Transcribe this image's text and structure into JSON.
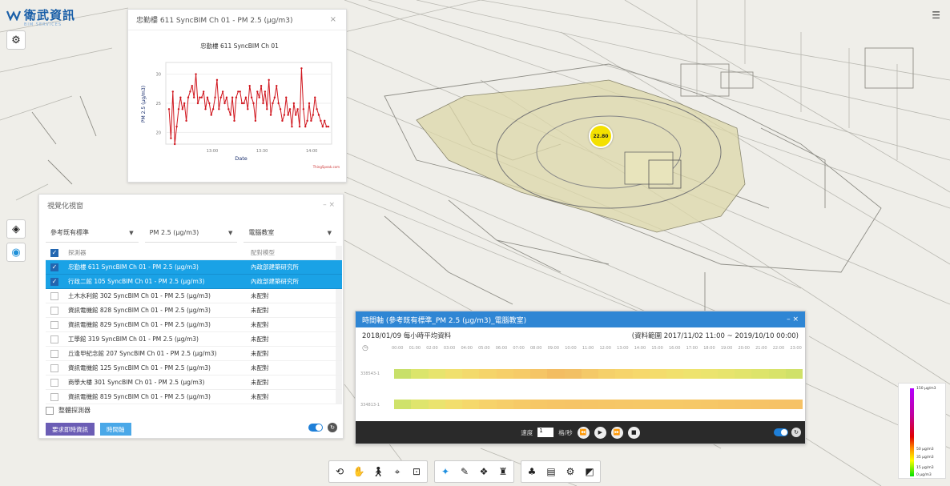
{
  "brand": {
    "name": "衛武資訊",
    "tagline": "BIM SERVICES"
  },
  "chart_panel": {
    "title": "忠勤樓 611 SyncBIM Ch 01 - PM 2.5 (μg/m3)",
    "close": "×"
  },
  "chart_data": {
    "type": "line",
    "title": "忠勤樓 611 SyncBIM Ch 01",
    "xlabel": "Date",
    "ylabel": "PM 2.5 (μg/m3)",
    "ylim": [
      18,
      32
    ],
    "yticks": [
      20,
      25,
      30
    ],
    "xticks": [
      "13:00",
      "13:30",
      "14:00"
    ],
    "credit": "ThingSpeak.com",
    "series": [
      {
        "color": "#d0161e",
        "values": [
          24,
          19,
          27,
          18,
          21,
          24,
          26,
          24,
          25,
          22,
          26,
          27,
          28,
          26,
          30,
          25,
          26,
          26,
          27,
          24,
          26,
          25,
          23,
          24,
          26,
          29,
          24,
          26,
          27,
          25,
          26,
          24,
          23,
          26,
          22,
          26,
          27,
          27,
          25,
          25,
          26,
          24,
          28,
          26,
          25,
          22,
          27,
          26,
          28,
          25,
          27,
          24,
          29,
          23,
          25,
          26,
          28,
          25,
          24,
          22,
          23,
          26,
          23,
          24,
          21,
          25,
          23,
          24,
          21,
          31,
          24,
          21,
          22,
          25,
          22,
          23,
          26,
          24,
          23,
          22,
          21,
          22,
          21,
          21
        ]
      }
    ]
  },
  "vis_panel": {
    "title": "視覺化視窗",
    "controls": "– ×",
    "filters": [
      "參考既有標準",
      "PM 2.5 (μg/m3)",
      "電腦教室"
    ],
    "headers": {
      "name": "探測器",
      "model": "配對模型"
    },
    "rows": [
      {
        "name": "忠勤樓 611 SyncBIM Ch 01 - PM 2.5 (μg/m3)",
        "model": "內政部建築研究所",
        "selected": true
      },
      {
        "name": "行政二館 105 SyncBIM Ch 01 - PM 2.5 (μg/m3)",
        "model": "內政部建築研究所",
        "selected": true
      },
      {
        "name": "土木水利館 302 SyncBIM Ch 01 - PM 2.5 (μg/m3)",
        "model": "未配對",
        "selected": false
      },
      {
        "name": "資訊電機館 828 SyncBIM Ch 01 - PM 2.5 (μg/m3)",
        "model": "未配對",
        "selected": false
      },
      {
        "name": "資訊電機館 829 SyncBIM Ch 01 - PM 2.5 (μg/m3)",
        "model": "未配對",
        "selected": false
      },
      {
        "name": "工學館 319 SyncBIM Ch 01 - PM 2.5 (μg/m3)",
        "model": "未配對",
        "selected": false
      },
      {
        "name": "丘逢甲紀念館 207 SyncBIM Ch 01 - PM 2.5 (μg/m3)",
        "model": "未配對",
        "selected": false
      },
      {
        "name": "資訊電機館 125 SyncBIM Ch 01 - PM 2.5 (μg/m3)",
        "model": "未配對",
        "selected": false
      },
      {
        "name": "商學大樓 301 SyncBIM Ch 01 - PM 2.5 (μg/m3)",
        "model": "未配對",
        "selected": false
      },
      {
        "name": "資訊電機館 819 SyncBIM Ch 01 - PM 2.5 (μg/m3)",
        "model": "未配對",
        "selected": false
      }
    ],
    "bind_label": "整體探測器",
    "realtime_btn": "要求即時資訊",
    "timeline_btn": "時間軸"
  },
  "timeline": {
    "title": "時間軸 (參考既有標準_PM 2.5 (μg/m3)_電腦教室)",
    "controls": "– ×",
    "date_label": "2018/01/09 每小時平均資料",
    "range_label": "(資料範圍 2017/11/02 11:00 ~ 2019/10/10 00:00)",
    "hours": [
      "00:00",
      "01:00",
      "02:00",
      "03:00",
      "04:00",
      "05:00",
      "06:00",
      "07:00",
      "08:00",
      "09:00",
      "10:00",
      "11:00",
      "12:00",
      "13:00",
      "14:00",
      "15:00",
      "16:00",
      "17:00",
      "18:00",
      "19:00",
      "20:00",
      "21:00",
      "22:00",
      "23:00"
    ],
    "rows": [
      {
        "label": "338543-1",
        "colors": [
          "#c8e06a",
          "#dbe56c",
          "#e7e46e",
          "#f0e06e",
          "#f3da6c",
          "#f5d46a",
          "#f6cf69",
          "#f6cb68",
          "#f5c566",
          "#f3bd62",
          "#f2c064",
          "#f4c968",
          "#f5d06a",
          "#f6d46b",
          "#f6d86c",
          "#f4dc6c",
          "#f1e06d",
          "#eee36e",
          "#ebe46e",
          "#e7e46d",
          "#e2e46c",
          "#dde46b",
          "#d8e36a",
          "#d0e169"
        ]
      },
      {
        "label": "334813-1",
        "colors": [
          "#cfe26a",
          "#dfe56d",
          "#eae36e",
          "#f2de6d",
          "#f5d86b",
          "#f6d26a",
          "#f6ce69",
          "#f6ca67",
          "#f6c766",
          "#f6c566",
          "#f6c466",
          "#f6c566",
          "#f6c666",
          "#f6c767",
          "#f6c867",
          "#f6c967",
          "#f6c967",
          "#f6c867",
          "#f6c767",
          "#f6c566",
          "#f6c466",
          "#f6c366",
          "#f6c266",
          "#f6c266"
        ]
      }
    ],
    "speed_label": "速度",
    "speed_value": "1",
    "speed_unit": "格/秒"
  },
  "marker": {
    "value": "22.80"
  },
  "legend": {
    "labels": [
      "150 μg/m3",
      "50 μg/m3",
      "35 μg/m3",
      "15 μg/m3",
      "0 μg/m3"
    ]
  }
}
